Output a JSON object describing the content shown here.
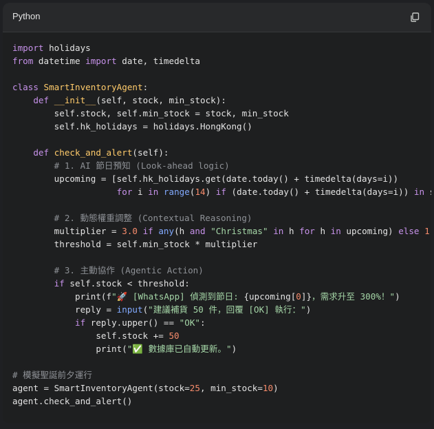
{
  "header": {
    "language": "Python",
    "copy_icon": "copy-icon"
  },
  "code": {
    "lines": [
      [
        [
          "kw",
          "import"
        ],
        [
          "t",
          " holidays"
        ]
      ],
      [
        [
          "kw",
          "from"
        ],
        [
          "t",
          " datetime "
        ],
        [
          "kw",
          "import"
        ],
        [
          "t",
          " date, timedelta"
        ]
      ],
      [],
      [
        [
          "kw",
          "class"
        ],
        [
          "t",
          " "
        ],
        [
          "cls",
          "SmartInventoryAgent"
        ],
        [
          "t",
          ":"
        ]
      ],
      [
        [
          "t",
          "    "
        ],
        [
          "kw",
          "def"
        ],
        [
          "t",
          " "
        ],
        [
          "fn",
          "__init__"
        ],
        [
          "t",
          "(self, stock, min_stock):"
        ]
      ],
      [
        [
          "t",
          "        self.stock, self.min_stock = stock, min_stock"
        ]
      ],
      [
        [
          "t",
          "        self.hk_holidays = holidays.HongKong()"
        ]
      ],
      [],
      [
        [
          "t",
          "    "
        ],
        [
          "kw",
          "def"
        ],
        [
          "t",
          " "
        ],
        [
          "fn",
          "check_and_alert"
        ],
        [
          "t",
          "(self):"
        ]
      ],
      [
        [
          "cm",
          "        # 1. AI 節日預知 (Look-ahead logic)"
        ]
      ],
      [
        [
          "t",
          "        upcoming = [self.hk_holidays.get(date.today() + timedelta(days=i))"
        ]
      ],
      [
        [
          "t",
          "                    "
        ],
        [
          "kw",
          "for"
        ],
        [
          "t",
          " i "
        ],
        [
          "kw",
          "in"
        ],
        [
          "t",
          " "
        ],
        [
          "bi",
          "range"
        ],
        [
          "t",
          "("
        ],
        [
          "nm",
          "14"
        ],
        [
          "t",
          ") "
        ],
        [
          "kw",
          "if"
        ],
        [
          "t",
          " (date.today() + timedelta(days=i)) "
        ],
        [
          "kw",
          "in"
        ],
        [
          "t",
          " s"
        ]
      ],
      [],
      [
        [
          "cm",
          "        # 2. 動態權重調整 (Contextual Reasoning)"
        ]
      ],
      [
        [
          "t",
          "        multiplier = "
        ],
        [
          "nm",
          "3.0"
        ],
        [
          "t",
          " "
        ],
        [
          "kw",
          "if"
        ],
        [
          "t",
          " "
        ],
        [
          "bi",
          "any"
        ],
        [
          "t",
          "(h "
        ],
        [
          "kw",
          "and"
        ],
        [
          "t",
          " "
        ],
        [
          "st",
          "\"Christmas\""
        ],
        [
          "t",
          " "
        ],
        [
          "kw",
          "in"
        ],
        [
          "t",
          " h "
        ],
        [
          "kw",
          "for"
        ],
        [
          "t",
          " h "
        ],
        [
          "kw",
          "in"
        ],
        [
          "t",
          " upcoming) "
        ],
        [
          "kw",
          "else"
        ],
        [
          "t",
          " "
        ],
        [
          "nm",
          "1."
        ]
      ],
      [
        [
          "t",
          "        threshold = self.min_stock * multiplier"
        ]
      ],
      [],
      [
        [
          "cm",
          "        # 3. 主動協作 (Agentic Action)"
        ]
      ],
      [
        [
          "t",
          "        "
        ],
        [
          "kw",
          "if"
        ],
        [
          "t",
          " self.stock < threshold:"
        ]
      ],
      [
        [
          "t",
          "            print(f"
        ],
        [
          "st",
          "\"🚀 [WhatsApp] 偵測到節日: "
        ],
        [
          "t",
          "{upcoming["
        ],
        [
          "nm",
          "0"
        ],
        [
          "t",
          "]}"
        ],
        [
          "st",
          "，需求升至 300%！\""
        ],
        [
          "t",
          ")"
        ]
      ],
      [
        [
          "t",
          "            reply = "
        ],
        [
          "bi",
          "input"
        ],
        [
          "t",
          "("
        ],
        [
          "st",
          "\"建議補貨 50 件，回覆 [OK] 執行：\""
        ],
        [
          "t",
          ")"
        ]
      ],
      [
        [
          "t",
          "            "
        ],
        [
          "kw",
          "if"
        ],
        [
          "t",
          " reply.upper() == "
        ],
        [
          "st",
          "\"OK\""
        ],
        [
          "t",
          ":"
        ]
      ],
      [
        [
          "t",
          "                self.stock += "
        ],
        [
          "nm",
          "50"
        ]
      ],
      [
        [
          "t",
          "                print("
        ],
        [
          "st",
          "\"✅ 數據庫已自動更新。\""
        ],
        [
          "t",
          ")"
        ]
      ],
      [],
      [
        [
          "cm",
          "# 模擬聖誕前夕運行"
        ]
      ],
      [
        [
          "t",
          "agent = SmartInventoryAgent(stock="
        ],
        [
          "nm",
          "25"
        ],
        [
          "t",
          ", min_stock="
        ],
        [
          "nm",
          "10"
        ],
        [
          "t",
          ")"
        ]
      ],
      [
        [
          "t",
          "agent.check_and_alert()"
        ]
      ]
    ]
  }
}
